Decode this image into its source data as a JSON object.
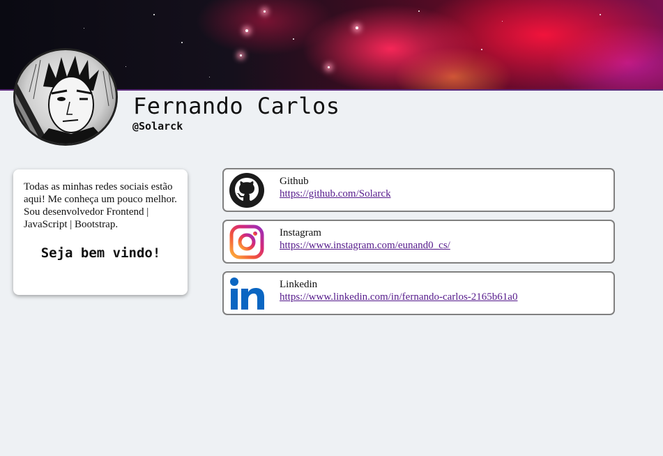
{
  "profile": {
    "name": "Fernando Carlos",
    "handle": "@Solarck"
  },
  "about": {
    "text": "Todas as minhas redes sociais estão aqui! Me conheça um pouco melhor. Sou desenvolvedor Frontend | JavaScript | Bootstrap.",
    "welcome": "Seja bem vindo!"
  },
  "links": [
    {
      "title": "Github",
      "url": "https://github.com/Solarck",
      "icon": "github-icon"
    },
    {
      "title": "Instagram",
      "url": "https://www.instagram.com/eunand0_cs/",
      "icon": "instagram-icon"
    },
    {
      "title": "Linkedin",
      "url": "https://www.linkedin.com/in/fernando-carlos-2165b61a0",
      "icon": "linkedin-icon"
    }
  ],
  "colors": {
    "background": "#eef1f4",
    "link_visited": "#551a8b",
    "card_border": "#808080",
    "linkedin_blue": "#0a66c2"
  }
}
